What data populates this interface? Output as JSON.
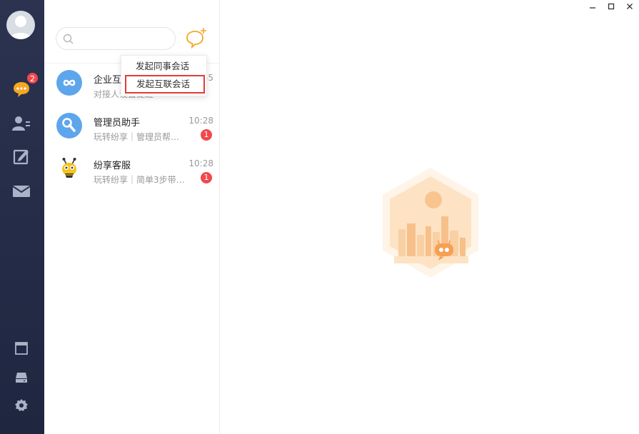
{
  "nav": {
    "unread_badge": "2",
    "items": [
      {
        "name": "messages",
        "icon": "chat-bubble-icon"
      },
      {
        "name": "contacts",
        "icon": "contacts-icon"
      },
      {
        "name": "notes",
        "icon": "edit-icon"
      },
      {
        "name": "mail",
        "icon": "mail-icon"
      },
      {
        "name": "window",
        "icon": "window-icon"
      },
      {
        "name": "storage",
        "icon": "storage-icon"
      },
      {
        "name": "settings",
        "icon": "gear-icon"
      }
    ]
  },
  "search": {
    "placeholder": "",
    "value": ""
  },
  "menu": {
    "items": [
      {
        "label": "发起同事会话"
      },
      {
        "label": "发起互联会话"
      }
    ]
  },
  "conversations": [
    {
      "name": "企业互",
      "time": "55",
      "subtitle": "对接人设置提醒",
      "badge": ""
    },
    {
      "name": "管理员助手",
      "time": "10:28",
      "subtitle": "玩转纷享｜管理员帮…",
      "badge": "1"
    },
    {
      "name": "纷享客服",
      "time": "10:28",
      "subtitle": "玩转纷享｜简单3步带…",
      "badge": "1"
    }
  ],
  "colors": {
    "accent": "#f5a623",
    "nav_bg": "#2b3350",
    "badge": "#f0484c",
    "highlight_border": "#e03b3b"
  }
}
